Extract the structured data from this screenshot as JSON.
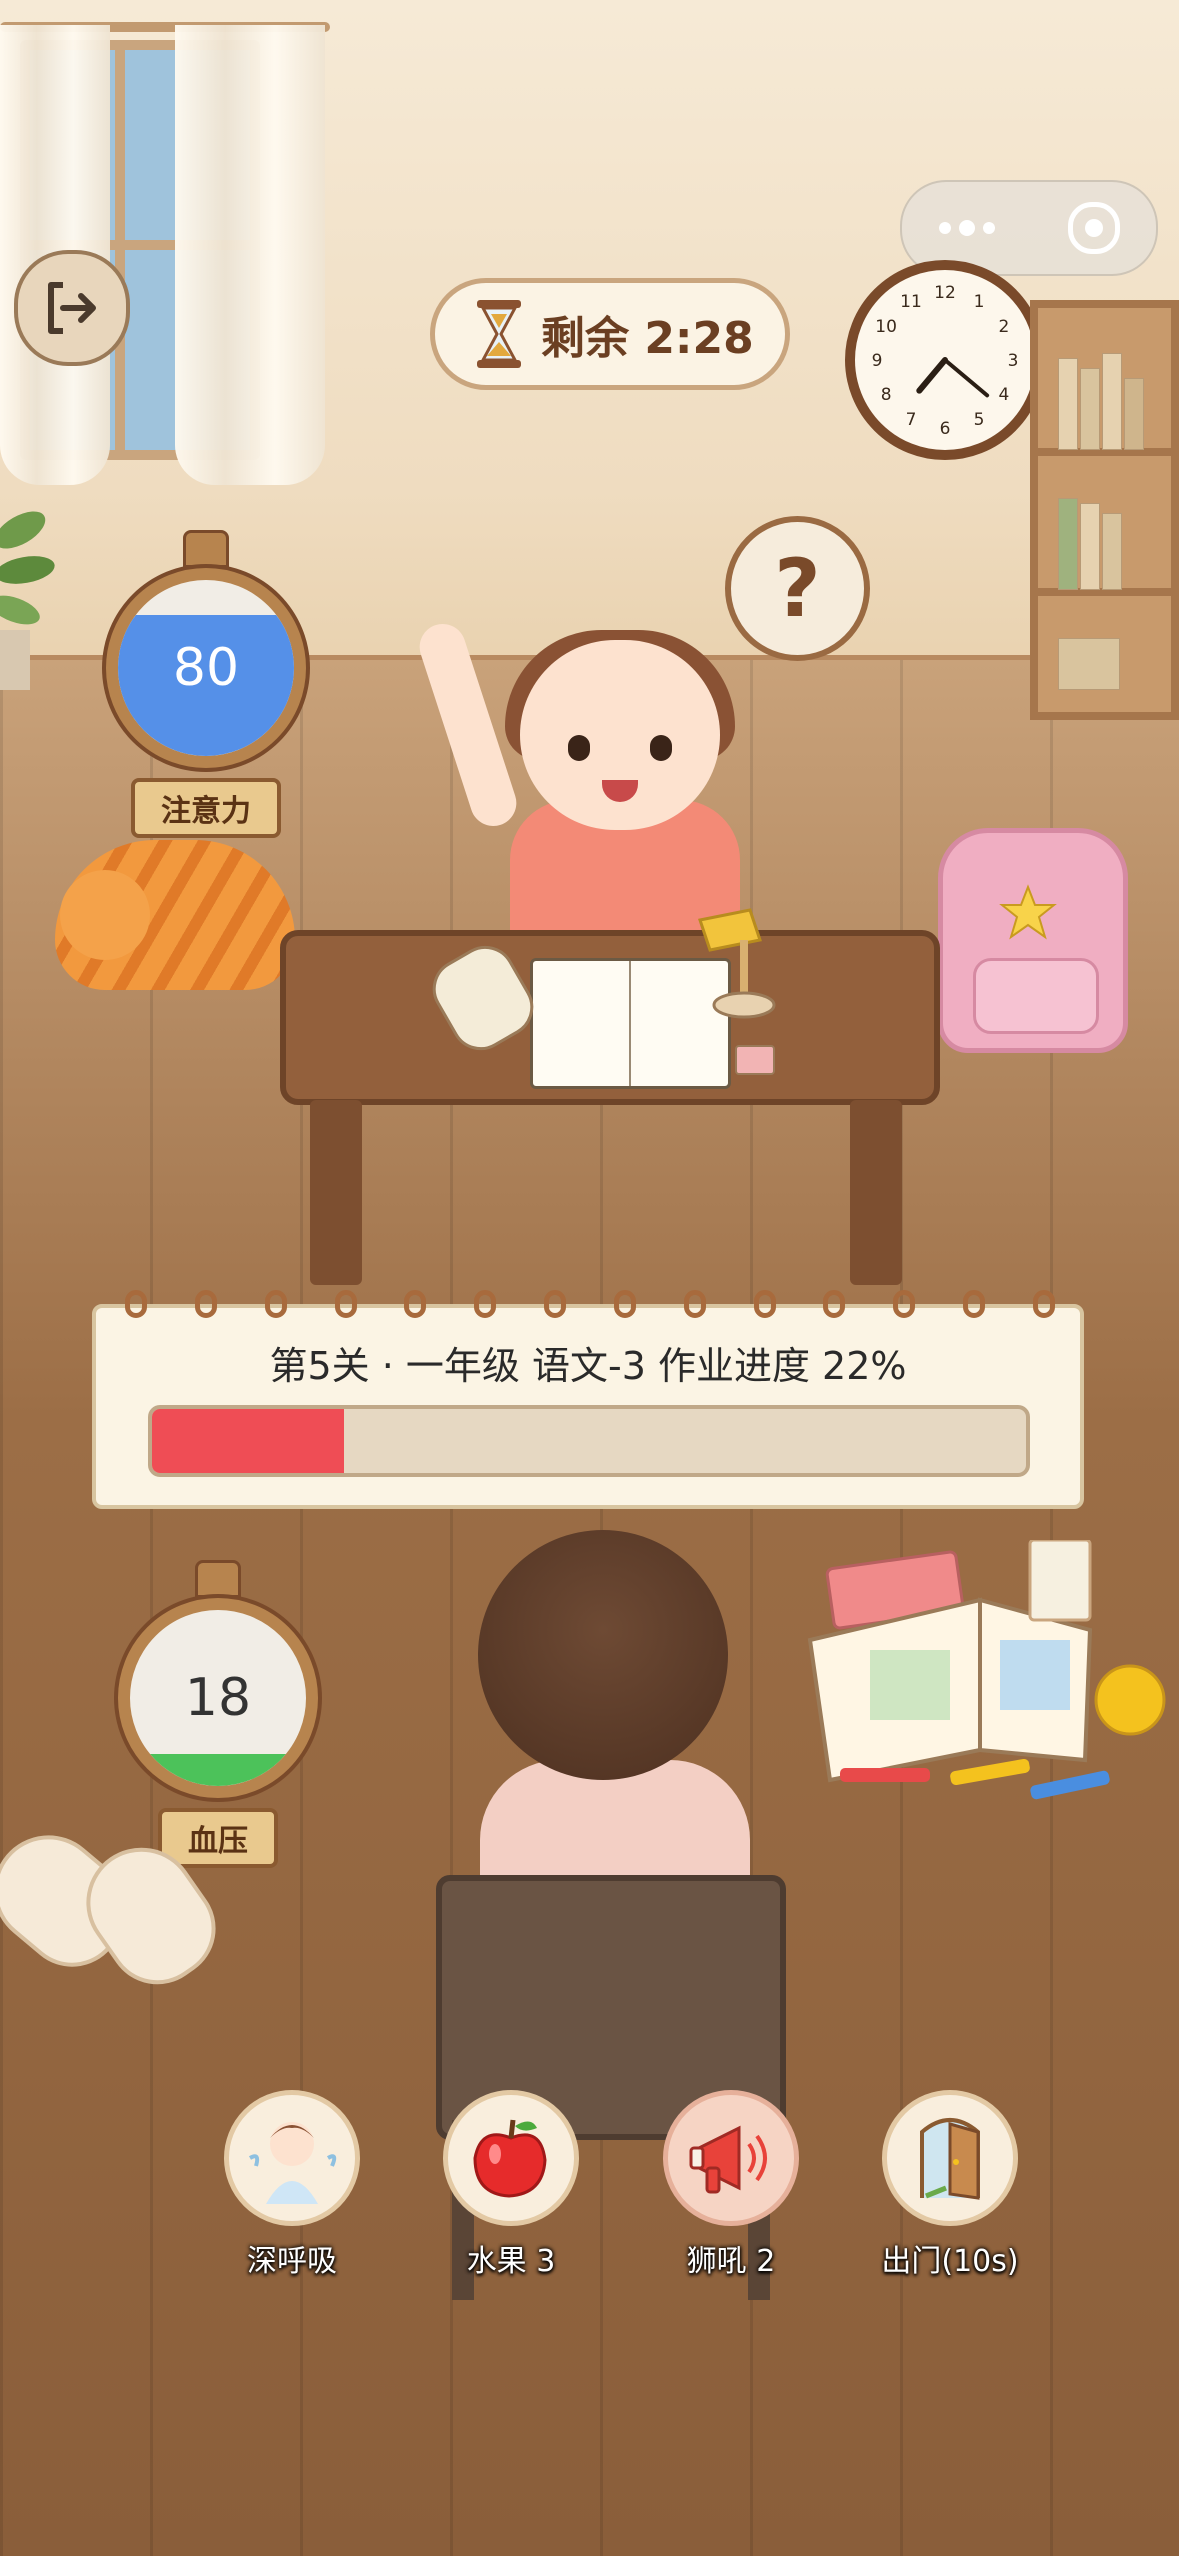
{
  "hud": {
    "timer_text": "剩余 2:28",
    "help_symbol": "?"
  },
  "gauges": {
    "attention": {
      "label": "注意力",
      "value": "80",
      "level": 0.8
    },
    "blood_pressure": {
      "label": "血压",
      "value": "18",
      "level": 0.18
    }
  },
  "progress": {
    "title": "第5关 · 一年级 语文-3  作业进度 22%",
    "percent": 22
  },
  "actions": [
    {
      "label": "深呼吸",
      "icon": "deep-breath-icon"
    },
    {
      "label": "水果 3",
      "icon": "apple-icon"
    },
    {
      "label": "狮吼 2",
      "icon": "megaphone-icon"
    },
    {
      "label": "出门(10s)",
      "icon": "door-icon"
    }
  ],
  "clock": {
    "numbers": [
      "12",
      "1",
      "2",
      "3",
      "4",
      "5",
      "6",
      "7",
      "8",
      "9",
      "10",
      "11"
    ]
  },
  "colors": {
    "progress_fill": "#ef4d55",
    "attention_fill": "#5590e8",
    "pressure_fill": "#4cc25a"
  }
}
